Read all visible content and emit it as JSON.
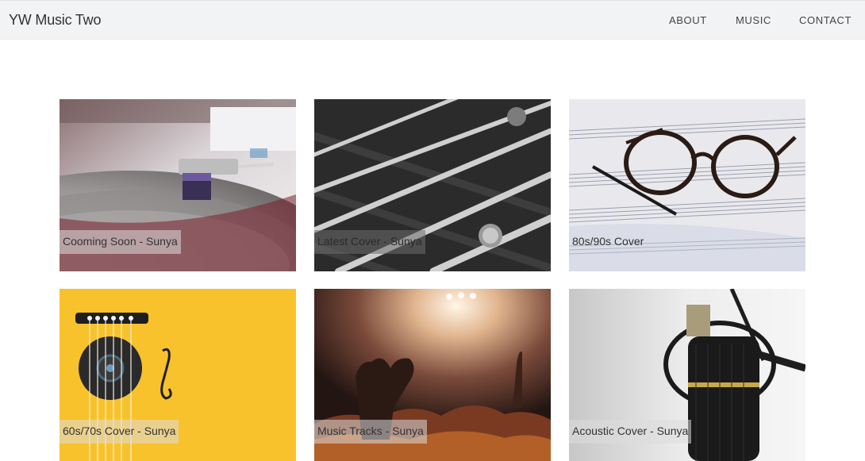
{
  "navbar": {
    "brand": "YW Music Two",
    "links": [
      {
        "label": "ABOUT"
      },
      {
        "label": "MUSIC"
      },
      {
        "label": "CONTACT"
      }
    ]
  },
  "gallery": {
    "cards": [
      {
        "caption": "Cooming Soon - Sunya",
        "image": "turntable-photo"
      },
      {
        "caption": "Latest Cover - Sunya",
        "image": "guitar-strings-photo"
      },
      {
        "caption": "80s/90s Cover",
        "image": "glasses-sheet-music-photo"
      },
      {
        "caption": "60s/70s Cover - Sunya",
        "image": "guitar-illustration"
      },
      {
        "caption": "Music Tracks - Sunya",
        "image": "concert-crowd-photo"
      },
      {
        "caption": "Acoustic Cover - Sunya",
        "image": "microphone-photo"
      }
    ]
  },
  "colors": {
    "navbar_bg": "#f2f3f4",
    "yellow_card": "#f8c22c"
  }
}
